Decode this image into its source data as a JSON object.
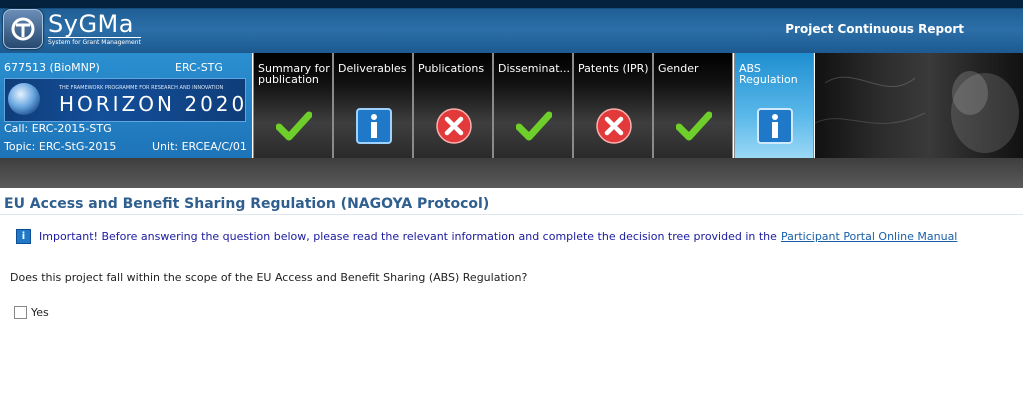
{
  "header": {
    "logo_name": "SyGMa",
    "logo_subtitle": "System for Grant Management",
    "app_title": "Project Continuous Report"
  },
  "project": {
    "id": "677513 (BioMNP)",
    "scheme": "ERC-STG",
    "programme_line": "THE FRAMEWORK PROGRAMME FOR RESEARCH AND INNOVATION",
    "programme_name": "HORIZON 2020",
    "call": "Call: ERC-2015-STG",
    "topic": "Topic: ERC-StG-2015",
    "unit": "Unit: ERCEA/C/01"
  },
  "tabs": [
    {
      "label": "Summary for publication",
      "status": "check-icon"
    },
    {
      "label": "Deliverables",
      "status": "info-icon"
    },
    {
      "label": "Publications",
      "status": "cross-icon"
    },
    {
      "label": "Disseminat...",
      "status": "check-icon"
    },
    {
      "label": "Patents (IPR)",
      "status": "cross-icon"
    },
    {
      "label": "Gender",
      "status": "check-icon"
    },
    {
      "label": "ABS Regulation",
      "status": "info-icon",
      "active": true
    }
  ],
  "section": {
    "title": "EU Access and Benefit Sharing Regulation (NAGOYA Protocol)",
    "note_text": "Important! Before answering the question below, please read the relevant information and complete the decision tree provided in the",
    "note_link": "Participant Portal Online Manual",
    "question": "Does this project fall within the scope of the EU Access and Benefit Sharing (ABS) Regulation?",
    "yes_label": "Yes"
  },
  "colors": {
    "accent": "#2f5f8f",
    "check": "#6fcf2a",
    "cross": "#e23a3a",
    "info": "#1f78c8"
  }
}
